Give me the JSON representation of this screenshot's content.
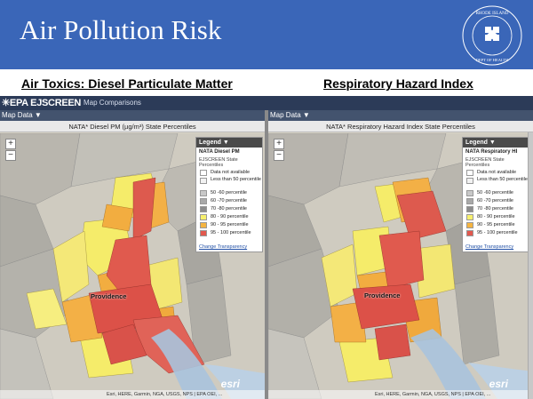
{
  "slide": {
    "title": "Air Pollution Risk",
    "seal": {
      "text": "RHODE ISLAND DEPARTMENT OF HEALTH",
      "primary_color": "#ffffff",
      "background": "#3a66b8"
    },
    "headings": {
      "left": "Air Toxics: Diesel Particulate Matter",
      "right": "Respiratory Hazard Index"
    }
  },
  "app": {
    "logo": "✳EPA EJSCREEN",
    "mode": "Map Comparisons"
  },
  "maps": [
    {
      "map_data_label": "Map Data ▼",
      "title": "NATA* Diesel PM (µg/m³) State Percentiles",
      "legend_header": "Legend ▼",
      "legend_layer": "NATA Diesel PM",
      "city_label": "Providence",
      "attribution": "Esri, HERE, Garmin, NGA, USGS, NPS | EPA OEI, ...",
      "esri_logo": "esri"
    },
    {
      "map_data_label": "Map Data ▼",
      "title": "NATA* Respiratory Hazard Index State Percentiles",
      "legend_header": "Legend ▼",
      "legend_layer": "NATA Respiratory HI",
      "city_label": "Providence",
      "attribution": "Esri, HERE, Garmin, NGA, USGS, NPS | EPA OEI, ...",
      "esri_logo": "esri"
    }
  ],
  "legend": {
    "caption": "EJSCREEN State Percentiles",
    "classes": [
      {
        "label": "Data not available",
        "color": "#ffffff"
      },
      {
        "label": "Less than 50 percentile",
        "color": "#f2f2f2"
      },
      {
        "label": "50 -60 percentile",
        "color": "#c8c8c8"
      },
      {
        "label": "60 -70 percentile",
        "color": "#a9a9a9"
      },
      {
        "label": "70 -80 percentile",
        "color": "#8c8c8c"
      },
      {
        "label": "80 - 90 percentile",
        "color": "#f7f06e"
      },
      {
        "label": "90 - 95 percentile",
        "color": "#f5b441"
      },
      {
        "label": "95 - 100 percentile",
        "color": "#e2584e"
      }
    ],
    "link": "Change Transparency"
  },
  "zoom": {
    "in": "+",
    "out": "−"
  }
}
